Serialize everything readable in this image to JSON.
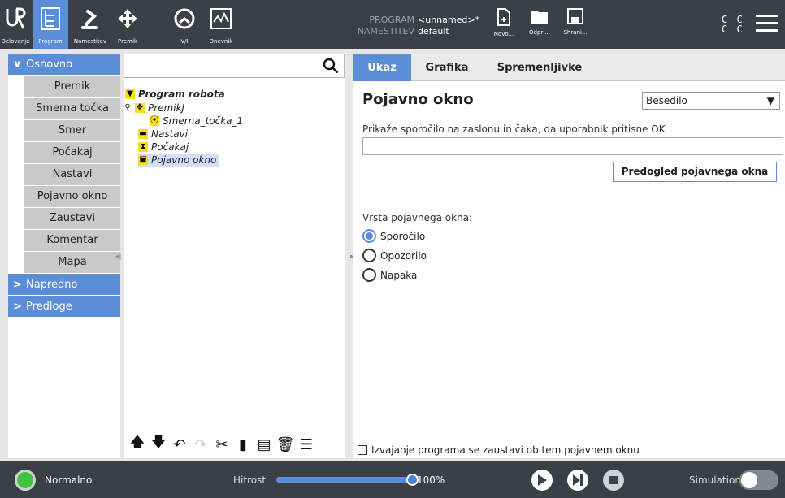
{
  "header": {
    "nav": [
      {
        "label": "Delovanje",
        "icon": "ur-logo-icon"
      },
      {
        "label": "Program",
        "icon": "program-tree-icon"
      },
      {
        "label": "Namestitev",
        "icon": "robot-arm-icon"
      },
      {
        "label": "Premik",
        "icon": "move-arrows-icon"
      },
      {
        "label": "V/I",
        "icon": "io-gauge-icon"
      },
      {
        "label": "Dnevnik",
        "icon": "log-chart-icon"
      }
    ],
    "program_label": "PROGRAM",
    "program_value": "<unnamed>*",
    "installation_label": "NAMESTITEV",
    "installation_value": "default",
    "file_buttons": [
      {
        "label": "Novo...",
        "icon": "new-file-icon"
      },
      {
        "label": "Odpri...",
        "icon": "folder-icon"
      },
      {
        "label": "Shrani...",
        "icon": "save-icon"
      }
    ],
    "cc_top": "C C",
    "cc_bottom": "C C"
  },
  "left_nav": {
    "basic_label": "Osnovno",
    "basic_items": [
      "Premik",
      "Smerna točka",
      "Smer",
      "Počakaj",
      "Nastavi",
      "Pojavno okno",
      "Zaustavi",
      "Komentar",
      "Mapa"
    ],
    "advanced_label": "Napredno",
    "templates_label": "Predloge"
  },
  "tree": {
    "search_placeholder": "",
    "root": "Program robota",
    "move": "PremikJ",
    "waypoint": "Smerna_točka_1",
    "set": "Nastavi",
    "wait": "Počakaj",
    "popup": "Pojavno okno"
  },
  "tabs": [
    "Ukaz",
    "Grafika",
    "Spremenljivke"
  ],
  "popup_panel": {
    "title": "Pojavno okno",
    "type_select": "Besedilo",
    "description": "Prikaže sporočilo na zaslonu in čaka, da uporabnik pritisne OK",
    "message_value": "",
    "preview_button": "Predogled pojavnega okna",
    "type_label": "Vrsta pojavnega okna:",
    "options": [
      "Sporočilo",
      "Opozorilo",
      "Napaka"
    ],
    "selected_option": "Sporočilo",
    "stop_checkbox_label": "Izvajanje programa se zaustavi ob tem pojavnem oknu",
    "stop_checked": false
  },
  "footer": {
    "status": "Normalno",
    "speed_label": "Hitrost",
    "speed_value": "100%",
    "speed_fraction": 1.0,
    "simulation_label": "Simulation"
  },
  "colors": {
    "accent": "#5b8ed6",
    "header_bg": "#3b3f46",
    "status_green": "#3ec43e"
  }
}
